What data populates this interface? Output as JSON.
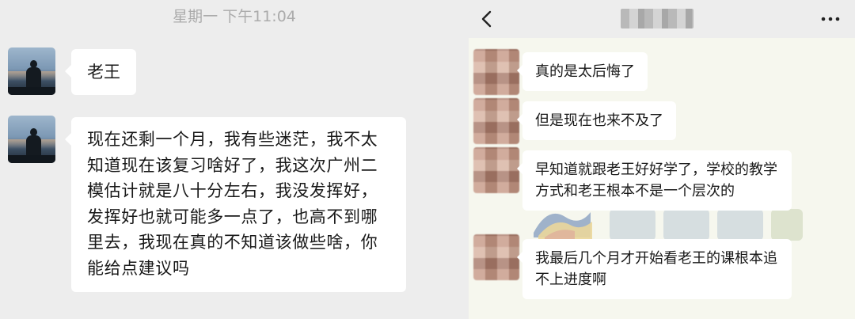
{
  "left_chat": {
    "timestamp": "星期一 下午11:04",
    "messages": [
      {
        "text": "老王"
      },
      {
        "text": "现在还剩一个月，我有些迷茫，我不太知道现在该复习啥好了，我这次广州二模估计就是八十分左右，我没发挥好，发挥好也就可能多一点了，也高不到哪里去，我现在真的不知道该做些啥，你能给点建议吗"
      }
    ]
  },
  "right_chat": {
    "header": {
      "contact_name": "",
      "back_icon": "chevron-left-icon",
      "more_icon": "more-dots-icon"
    },
    "messages": [
      {
        "text": "真的是太后悔了"
      },
      {
        "text": "但是现在也来不及了"
      },
      {
        "text": "早知道就跟老王好好学了，学校的教学方式和老王根本不是一个层次的"
      },
      {
        "text": "我最后几个月才开始看老王的课根本追不上进度啊"
      }
    ]
  },
  "colors": {
    "left_background": "#ededed",
    "right_background": "#f6f7ee",
    "bubble": "#ffffff",
    "timestamp": "#ababab",
    "text": "#191919"
  }
}
